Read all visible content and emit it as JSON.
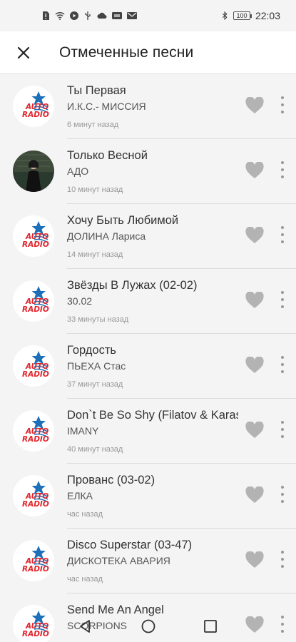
{
  "status_bar": {
    "time": "22:03",
    "battery": "100",
    "left_icons": [
      "sim-alert-icon",
      "wifi-icon",
      "play-icon",
      "usb-icon",
      "cloud-icon",
      "nfc-icon",
      "mail-icon"
    ],
    "right_icons": [
      "bluetooth-icon",
      "battery-icon"
    ]
  },
  "header": {
    "title": "Отмеченные песни",
    "close_icon": "close-icon"
  },
  "colors": {
    "background": "#f4f4f4",
    "header_bg": "#ffffff",
    "heart": "#b3b3b3",
    "logo_red": "#e3242b",
    "logo_blue": "#1d6fb8"
  },
  "songs": [
    {
      "title": "Ты Первая",
      "artist": "И.К.С.- МИССИЯ",
      "time": "6 минут назад",
      "avatar": "autoradio-logo"
    },
    {
      "title": "Только Весной",
      "artist": "АДО",
      "time": "10 минут назад",
      "avatar": "artist-photo"
    },
    {
      "title": "Хочу Быть Любимой",
      "artist": "ДОЛИНА Лариса",
      "time": "14 минут назад",
      "avatar": "autoradio-logo"
    },
    {
      "title": "Звёзды В Лужах (02-02)",
      "artist": "30.02",
      "time": "33 минуты назад",
      "avatar": "autoradio-logo"
    },
    {
      "title": "Гордость",
      "artist": "ПЬЕХА Стас",
      "time": "37 минут назад",
      "avatar": "autoradio-logo"
    },
    {
      "title": "Don`t Be So Shy (Filatov & Karas",
      "artist": "IMANY",
      "time": "40 минут назад",
      "avatar": "autoradio-logo"
    },
    {
      "title": "Прованс (03-02)",
      "artist": "ЕЛКА",
      "time": "час назад",
      "avatar": "autoradio-logo"
    },
    {
      "title": "Disco Superstar (03-47)",
      "artist": "ДИСКОТЕКА АВАРИЯ",
      "time": "час назад",
      "avatar": "autoradio-logo"
    },
    {
      "title": "Send Me An Angel",
      "artist": "SCORPIONS",
      "time": "",
      "avatar": "autoradio-logo"
    }
  ],
  "logo": {
    "line1": "AUTO",
    "line2": "RADIO"
  },
  "nav_bar": {
    "icons": [
      "back-icon",
      "home-icon",
      "recents-icon"
    ]
  }
}
